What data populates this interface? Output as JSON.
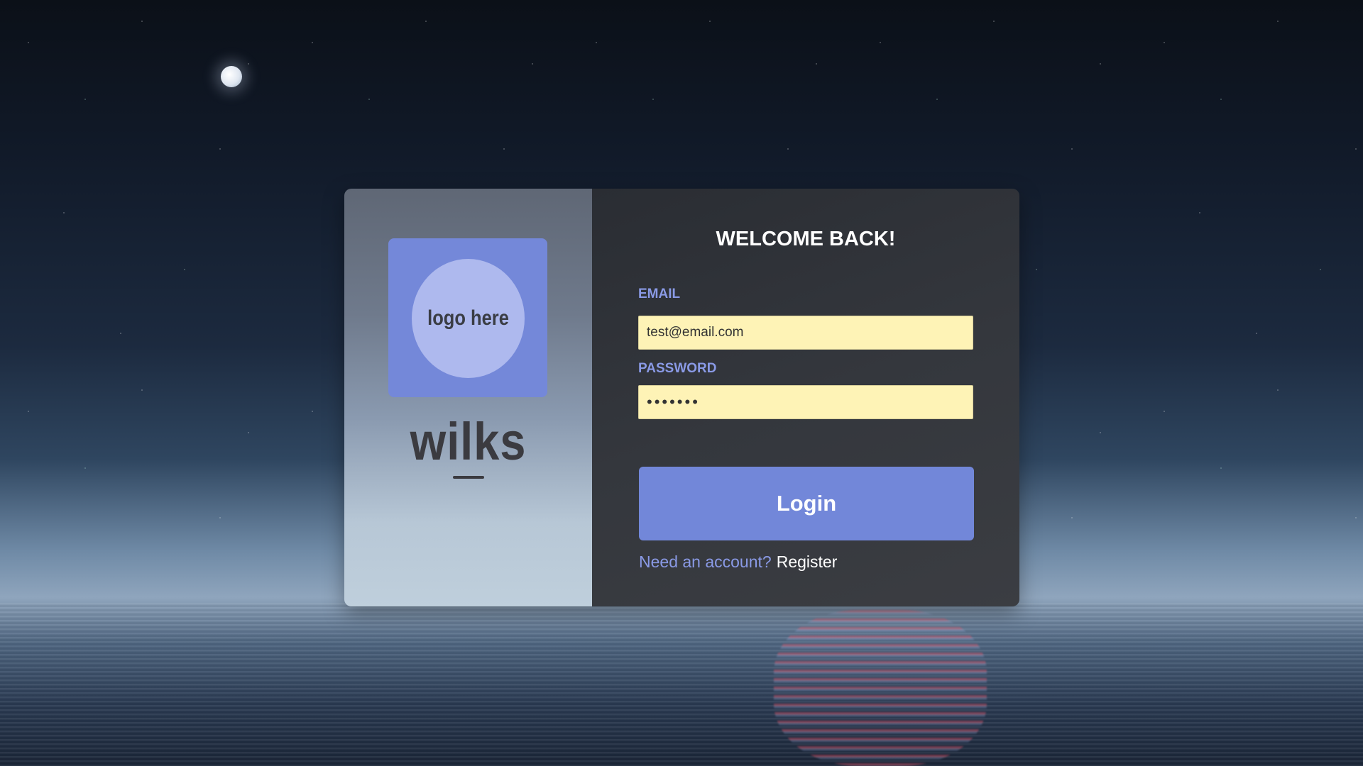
{
  "login": {
    "title": "WELCOME BACK!",
    "email_label": "EMAIL",
    "email_value": "test@email.com",
    "password_label": "PASSWORD",
    "password_value": "•••••••",
    "login_button": "Login",
    "register_prompt": "Need an account?",
    "register_link": "Register"
  },
  "brand": {
    "logo_placeholder": "logo here",
    "wordmark": "wilks"
  },
  "colors": {
    "accent": "#7287d9",
    "label": "#8a9ae6",
    "input_background": "#fef3b6",
    "form_background": "#2f3237"
  }
}
